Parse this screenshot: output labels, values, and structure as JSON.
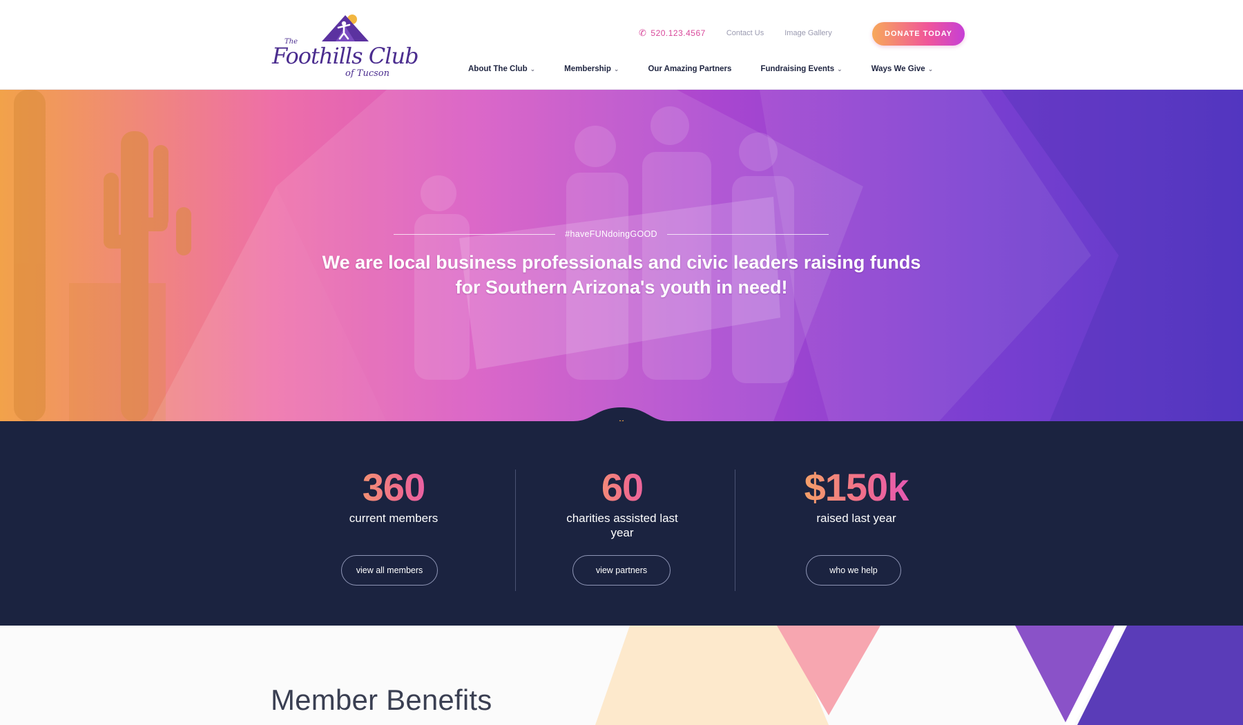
{
  "header": {
    "logo": {
      "the": "The",
      "main": "Foothills Club",
      "sub": "of Tucson"
    },
    "phone": "520.123.4567",
    "links": [
      "Contact Us",
      "Image Gallery"
    ],
    "donate_label": "DONATE TODAY",
    "nav": [
      {
        "label": "About The Club",
        "has_dropdown": true
      },
      {
        "label": "Membership",
        "has_dropdown": true
      },
      {
        "label": "Our Amazing Partners",
        "has_dropdown": false
      },
      {
        "label": "Fundraising Events",
        "has_dropdown": true
      },
      {
        "label": "Ways We Give",
        "has_dropdown": true
      }
    ]
  },
  "hero": {
    "tagline": "#haveFUNdoingGOOD",
    "headline": "We are local business professionals and civic leaders raising funds for Southern Arizona's youth in need!"
  },
  "stats": [
    {
      "number": "360",
      "label": "current members",
      "button": "view all members"
    },
    {
      "number": "60",
      "label": "charities assisted last year",
      "button": "view partners"
    },
    {
      "number": "$150k",
      "label": "raised last year",
      "button": "who we help"
    }
  ],
  "benefits": {
    "title": "Member Benefits"
  },
  "colors": {
    "navy": "#1b2340",
    "brand_purple": "#4b2d8f",
    "accent_pink": "#d8479a",
    "accent_orange": "#f0a446"
  },
  "icons": [
    "phone-icon",
    "chevron-down-icon",
    "logo-mountain-icon"
  ]
}
